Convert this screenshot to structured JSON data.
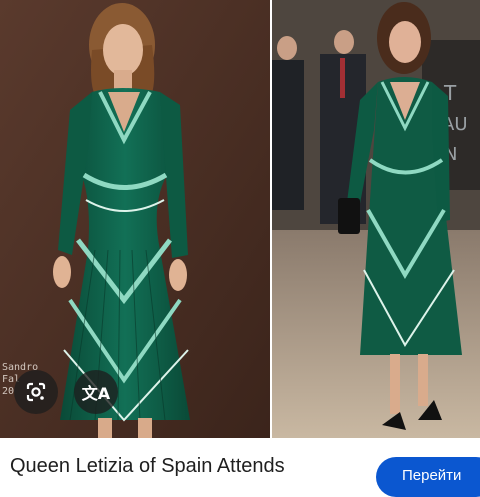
{
  "left_image": {
    "caption_lines": [
      "Sandro",
      "Fal",
      "20"
    ],
    "description": "model in green bandana-print pleated midi dress"
  },
  "right_image": {
    "description": "Queen Letizia in green bandana-print pleated midi dress with black clutch and heels"
  },
  "overlay_buttons": {
    "lens_icon": "google-lens-icon",
    "translate_icon": "translate-icon",
    "translate_glyph": "文A"
  },
  "result": {
    "title": "Queen Letizia of Spain Attends",
    "visit_label": "Перейти"
  },
  "colors": {
    "dress_green": "#0f5b44",
    "pattern_light": "#8fd9c2",
    "button_blue": "#0b57d0"
  }
}
